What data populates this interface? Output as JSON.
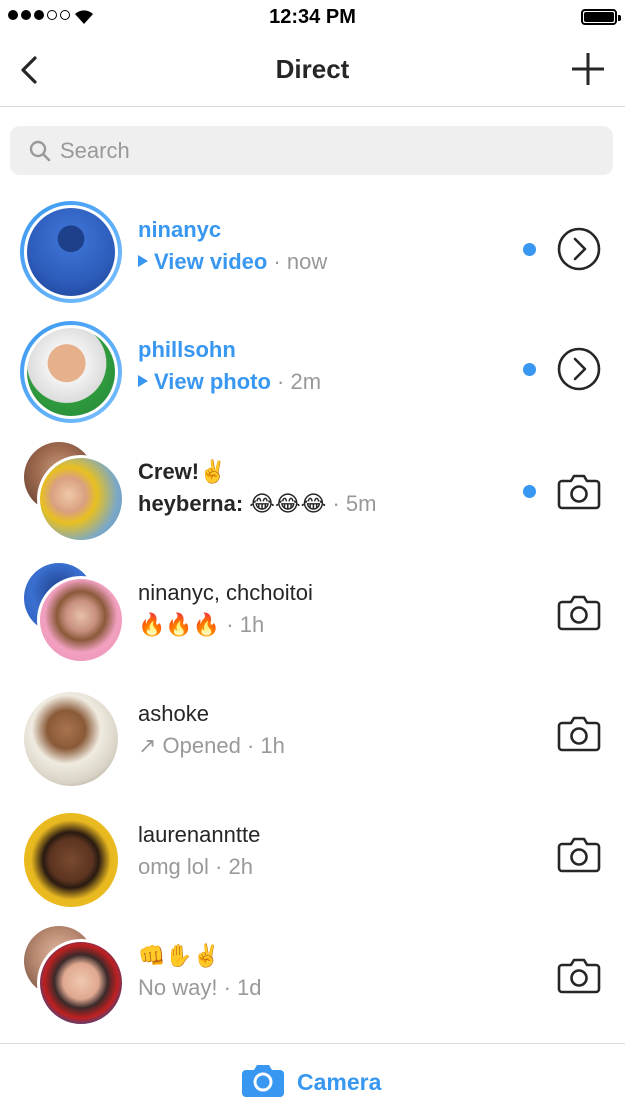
{
  "status_bar": {
    "time": "12:34 PM",
    "signal_dots_filled": 3,
    "signal_dots_total": 5,
    "battery_level": 1.0
  },
  "nav": {
    "title": "Direct",
    "back_icon": "chevron-left-icon",
    "new_icon": "plus-icon"
  },
  "search": {
    "placeholder": "Search",
    "icon": "search-icon"
  },
  "threads": [
    {
      "name": "ninanyc",
      "name_style": "blue",
      "prefix": "▸",
      "action_text": "View video",
      "meta": " · now",
      "unread": true,
      "action_icon": "chevron-right-circle-icon"
    },
    {
      "name": "phillsohn",
      "name_style": "blue",
      "prefix": "▸",
      "action_text": "View photo",
      "meta": " · 2m",
      "unread": true,
      "action_icon": "chevron-right-circle-icon"
    },
    {
      "name": "Crew!✌️",
      "name_style": "bold",
      "sender": "heyberna: 😂😂😂",
      "meta": " · 5m",
      "unread": true,
      "action_icon": "camera-icon"
    },
    {
      "name": "ninanyc, chchoitoi",
      "name_style": "normal",
      "message": "🔥🔥🔥",
      "meta": " · 1h",
      "unread": false,
      "action_icon": "camera-icon"
    },
    {
      "name": "ashoke",
      "name_style": "normal",
      "message": "↗ Opened",
      "meta": " · 1h",
      "unread": false,
      "action_icon": "camera-icon"
    },
    {
      "name": "laurenanntte",
      "name_style": "normal",
      "message": "omg lol",
      "meta": " · 2h",
      "unread": false,
      "action_icon": "camera-icon"
    },
    {
      "name": "👊✋✌️",
      "name_style": "normal",
      "message": "No way!",
      "meta": " · 1d",
      "unread": false,
      "action_icon": "camera-icon"
    }
  ],
  "bottom_bar": {
    "label": "Camera",
    "icon": "camera-icon"
  },
  "colors": {
    "accent": "#3897f0",
    "text": "#262626",
    "muted": "#999999",
    "divider": "#dbdbdb"
  }
}
